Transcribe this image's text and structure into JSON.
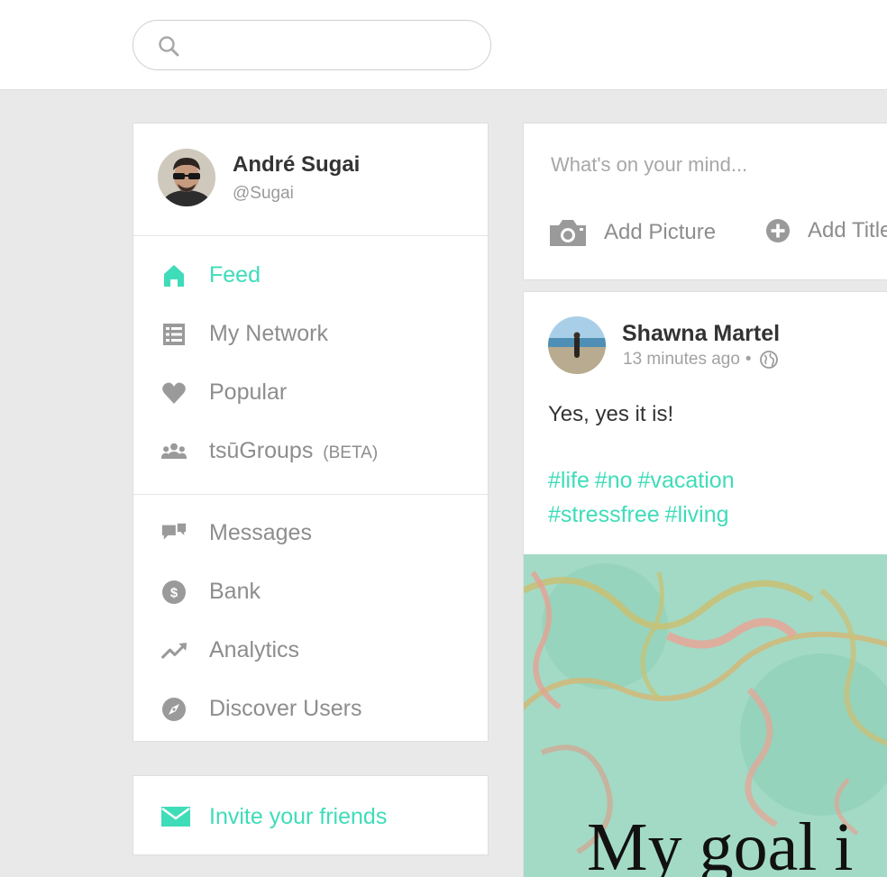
{
  "search": {
    "placeholder": "",
    "icon": "search-icon"
  },
  "user": {
    "name": "André Sugai",
    "handle": "@Sugai"
  },
  "nav_primary": [
    {
      "label": "Feed",
      "icon": "home-icon",
      "active": true
    },
    {
      "label": "My Network",
      "icon": "network-list-icon",
      "active": false
    },
    {
      "label": "Popular",
      "icon": "heart-icon",
      "active": false
    },
    {
      "label": "tsūGroups",
      "suffix": "(BETA)",
      "icon": "group-icon",
      "active": false
    }
  ],
  "nav_secondary": [
    {
      "label": "Messages",
      "icon": "chat-bubbles-icon"
    },
    {
      "label": "Bank",
      "icon": "dollar-coin-icon"
    },
    {
      "label": "Analytics",
      "icon": "trend-up-icon"
    },
    {
      "label": "Discover Users",
      "icon": "compass-icon"
    }
  ],
  "invite": {
    "label": "Invite your friends",
    "icon": "envelope-icon"
  },
  "composer": {
    "placeholder": "What's on your mind...",
    "add_picture": "Add Picture",
    "add_title": "Add Title"
  },
  "post": {
    "author": "Shawna Martel",
    "time": "13 minutes ago",
    "separator": "•",
    "visibility_icon": "globe-icon",
    "text": "Yes, yes it is!",
    "hashtags": [
      "#life",
      "#no",
      "#vacation",
      "#stressfree",
      "#living"
    ],
    "image_caption": "My goal i"
  },
  "colors": {
    "accent": "#3fdcb9",
    "muted": "#8d8d8d",
    "background": "#e9e9e9"
  }
}
